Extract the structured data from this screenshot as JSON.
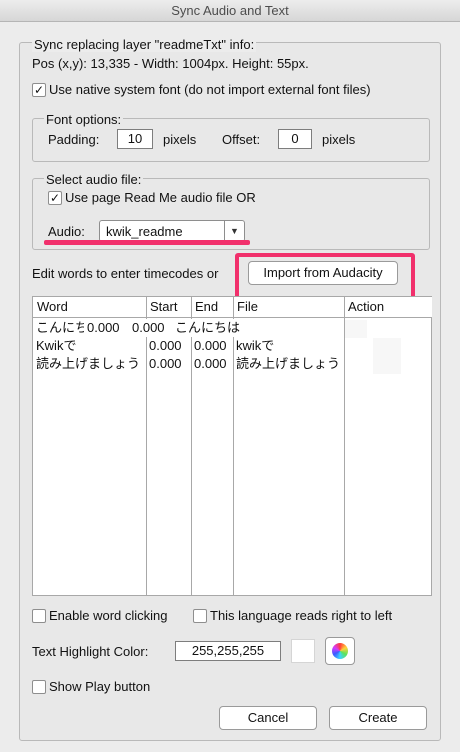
{
  "window": {
    "title": "Sync Audio and Text"
  },
  "info": {
    "heading": "Sync replacing layer \"readmeTxt\" info:",
    "pos_line": "Pos (x,y): 13,335 - Width: 1004px. Height: 55px."
  },
  "native_font": {
    "label": "Use native system font (do not import external font files)",
    "checked": "✓"
  },
  "font_options": {
    "legend": "Font options:",
    "padding_label": "Padding:",
    "padding_value": "10",
    "padding_unit": "pixels",
    "offset_label": "Offset:",
    "offset_value": "0",
    "offset_unit": "pixels"
  },
  "audio_file": {
    "legend": "Select audio file:",
    "use_page_label": "Use page Read Me audio file  OR",
    "use_page_checked": "✓",
    "audio_label": "Audio:",
    "audio_value": "kwik_readme",
    "arrow": "▼"
  },
  "edit_words": {
    "label": "Edit words to enter timecodes or",
    "import_button": "Import from Audacity"
  },
  "table": {
    "columns": [
      "Word",
      "Start",
      "End",
      "File",
      "Action"
    ],
    "rows": [
      {
        "word": "こんにちは",
        "start": "0.000",
        "end": "0.000",
        "file": "こんにちは"
      },
      {
        "word": "Kwikで",
        "start": "0.000",
        "end": "0.000",
        "file": "kwikで"
      },
      {
        "word": "読み上げましょう",
        "start": "0.000",
        "end": "0.000",
        "file": "読み上げましょう"
      }
    ]
  },
  "options": {
    "word_clicking": "Enable word clicking",
    "right_to_left": "This language reads right to left",
    "highlight_label": "Text Highlight Color:",
    "highlight_value": "255,255,255",
    "show_play": "Show Play button"
  },
  "buttons": {
    "cancel": "Cancel",
    "create": "Create"
  },
  "colors": {
    "highlight_marker": "#f1306c",
    "swatch": "#ffffff"
  }
}
